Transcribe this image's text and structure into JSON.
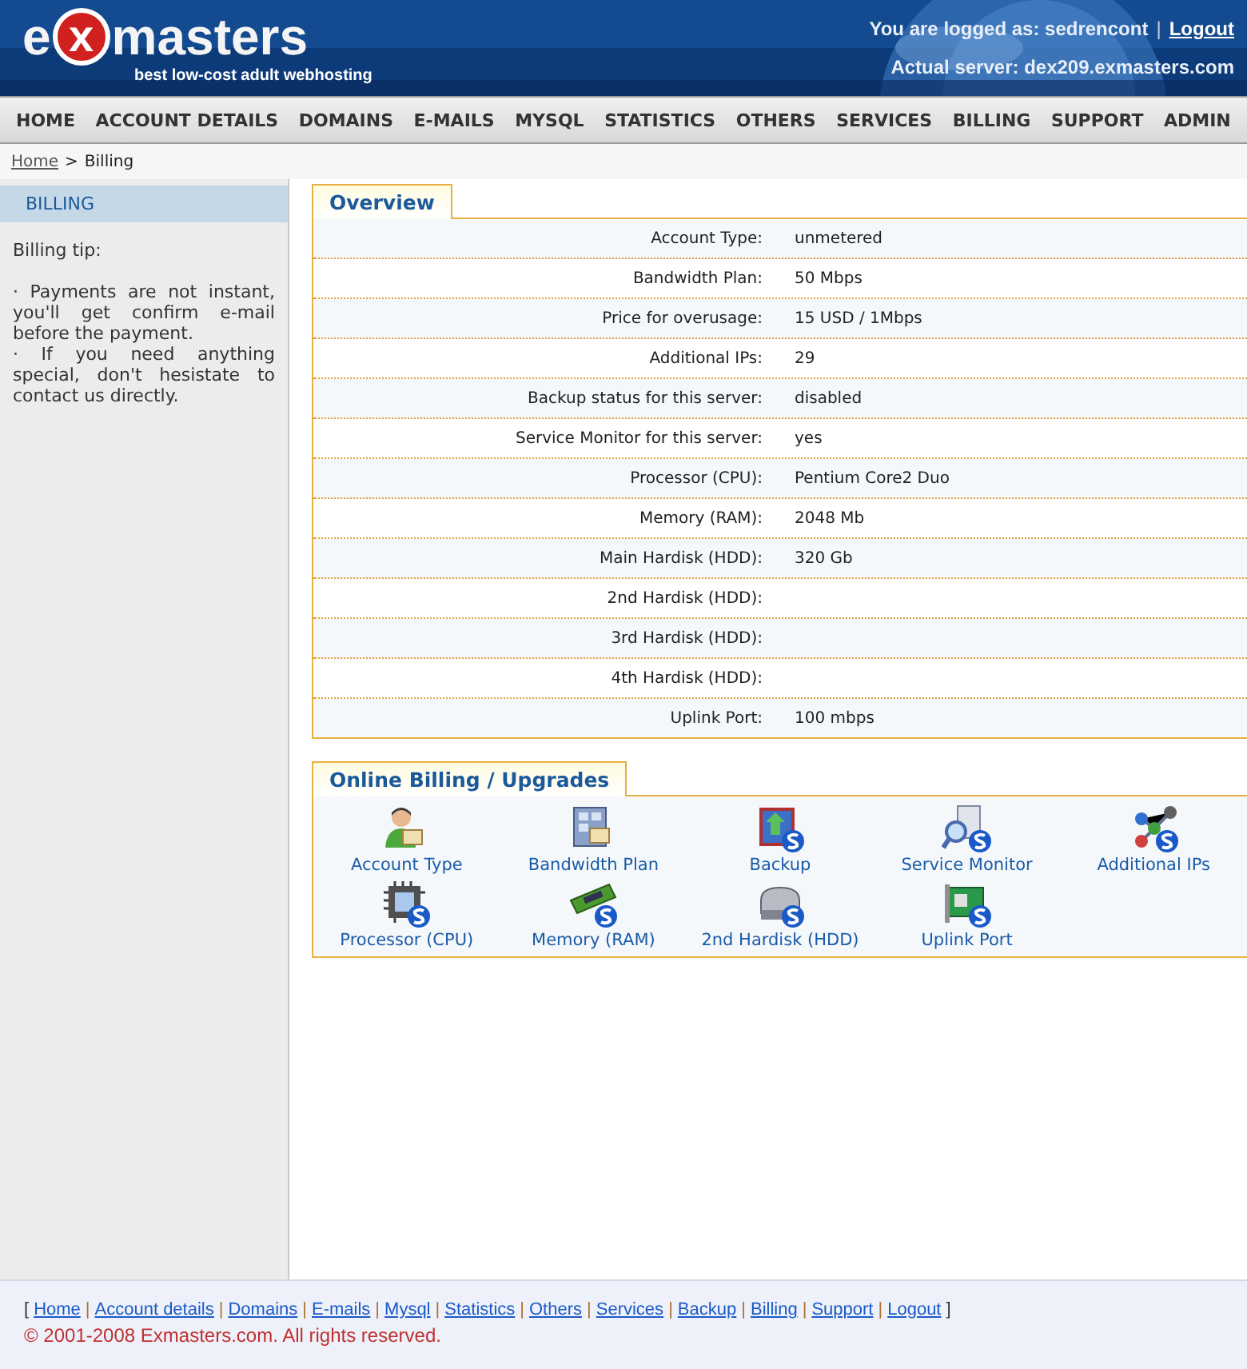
{
  "logo": {
    "prefix": "e",
    "mark": "x",
    "name": "masters",
    "tagline": "best low-cost adult webhosting"
  },
  "user": {
    "logged_as": "You are logged as: sedrencont",
    "separator": "|",
    "logout": "Logout",
    "server": "Actual server: dex209.exmasters.com"
  },
  "nav": [
    "HOME",
    "ACCOUNT DETAILS",
    "DOMAINS",
    "E-MAILS",
    "MYSQL",
    "STATISTICS",
    "OTHERS",
    "SERVICES",
    "BILLING",
    "SUPPORT",
    "ADMIN"
  ],
  "breadcrumb": {
    "link": "Home",
    "separator": ">",
    "current": "Billing"
  },
  "sidebar": {
    "title": "BILLING",
    "tip_title": "Billing tip:",
    "tips": [
      "· Payments are not instant, you'll get confirm e-mail before the payment.",
      "· If you need anything special, don't hesistate to contact us directly."
    ]
  },
  "overview": {
    "title": "Overview",
    "rows": [
      {
        "label": "Account Type:",
        "value": "unmetered"
      },
      {
        "label": "Bandwidth Plan:",
        "value": "50 Mbps"
      },
      {
        "label": "Price for overusage:",
        "value": "15 USD / 1Mbps"
      },
      {
        "label": "Additional IPs:",
        "value": "29"
      },
      {
        "label": "Backup status for this server:",
        "value": "disabled"
      },
      {
        "label": "Service Monitor for this server:",
        "value": "yes"
      },
      {
        "label": "Processor (CPU):",
        "value": "Pentium Core2 Duo"
      },
      {
        "label": "Memory (RAM):",
        "value": "2048 Mb"
      },
      {
        "label": "Main Hardisk (HDD):",
        "value": "320 Gb"
      },
      {
        "label": "2nd Hardisk (HDD):"
      },
      {
        "label": "3rd Hardisk (HDD):"
      },
      {
        "label": "4th Hardisk (HDD):"
      },
      {
        "label": "Uplink Port:",
        "value": "100 mbps"
      }
    ]
  },
  "upgrades": {
    "title": "Online Billing / Upgrades",
    "items": [
      "Account Type",
      "Bandwidth Plan",
      "Backup",
      "Service Monitor",
      "Additional IPs",
      "Processor (CPU)",
      "Memory (RAM)",
      "2nd Hardisk (HDD)",
      "Uplink Port"
    ]
  },
  "footer": {
    "open": "[",
    "close": "]",
    "links": [
      "Home",
      "Account details",
      "Domains",
      "E-mails",
      "Mysql",
      "Statistics",
      "Others",
      "Services",
      "Backup",
      "Billing",
      "Support",
      "Logout"
    ],
    "separators": [
      "|",
      "|",
      "|",
      "|",
      "|",
      "|",
      "|",
      "|",
      "|",
      "|",
      "|"
    ],
    "copyright": "© 2001-2008 Exmasters.com. All rights reserved."
  }
}
